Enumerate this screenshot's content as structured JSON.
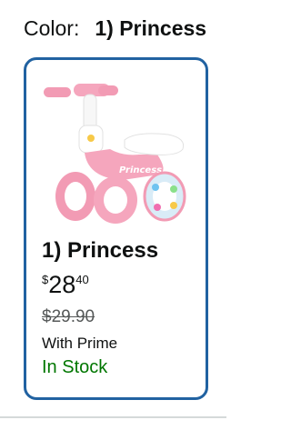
{
  "color_selector": {
    "label": "Color:",
    "selected_value": "1) Princess"
  },
  "swatch": {
    "name": "1) Princess",
    "image_text": "Princess",
    "price": {
      "symbol": "$",
      "whole": "28",
      "fraction": "40"
    },
    "list_price": "$29.90",
    "prime_note": "With Prime",
    "availability": "In Stock"
  },
  "colors": {
    "selected_border": "#2162A1",
    "in_stock": "#007600",
    "product_pink": "#F5A6BD"
  }
}
